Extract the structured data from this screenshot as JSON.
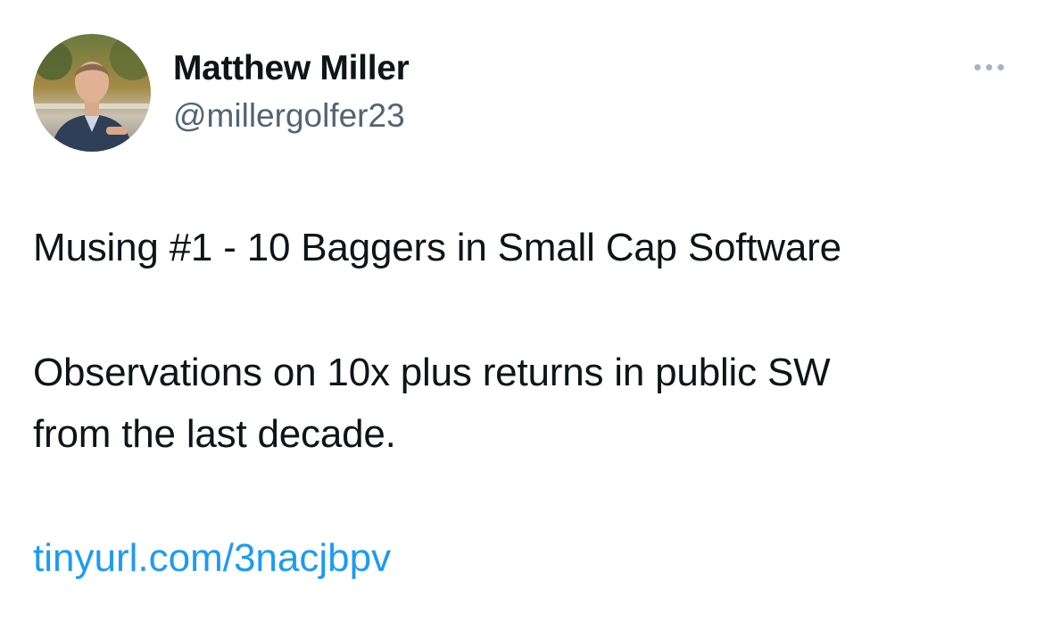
{
  "author": {
    "display_name": "Matthew Miller",
    "handle": "@millergolfer23"
  },
  "tweet": {
    "lines": [
      "Musing #1 - 10 Baggers in Small Cap Software",
      "Observations on 10x plus returns in public SW",
      "from the last decade."
    ],
    "link_text": "tinyurl.com/3nacjbpv"
  },
  "icons": {
    "more": "more-horizontal-icon"
  },
  "colors": {
    "text": "#0f1419",
    "secondary": "#536471",
    "link": "#1d9bf0",
    "more_dots": "#a9b3bb"
  }
}
